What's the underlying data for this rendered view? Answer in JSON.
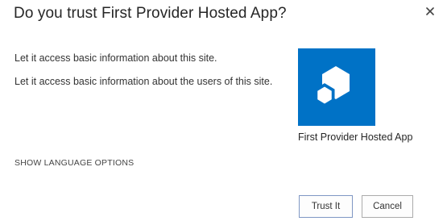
{
  "dialog": {
    "title": "Do you trust First Provider Hosted App?",
    "close_icon": "close-icon"
  },
  "permissions": [
    "Let it access basic information about this site.",
    "Let it access basic information about the users of this site."
  ],
  "app": {
    "name": "First Provider Hosted App",
    "icon": "app-cubes-icon",
    "tile_color": "#0072c6"
  },
  "language_link": "SHOW LANGUAGE OPTIONS",
  "buttons": {
    "trust": "Trust It",
    "cancel": "Cancel"
  }
}
